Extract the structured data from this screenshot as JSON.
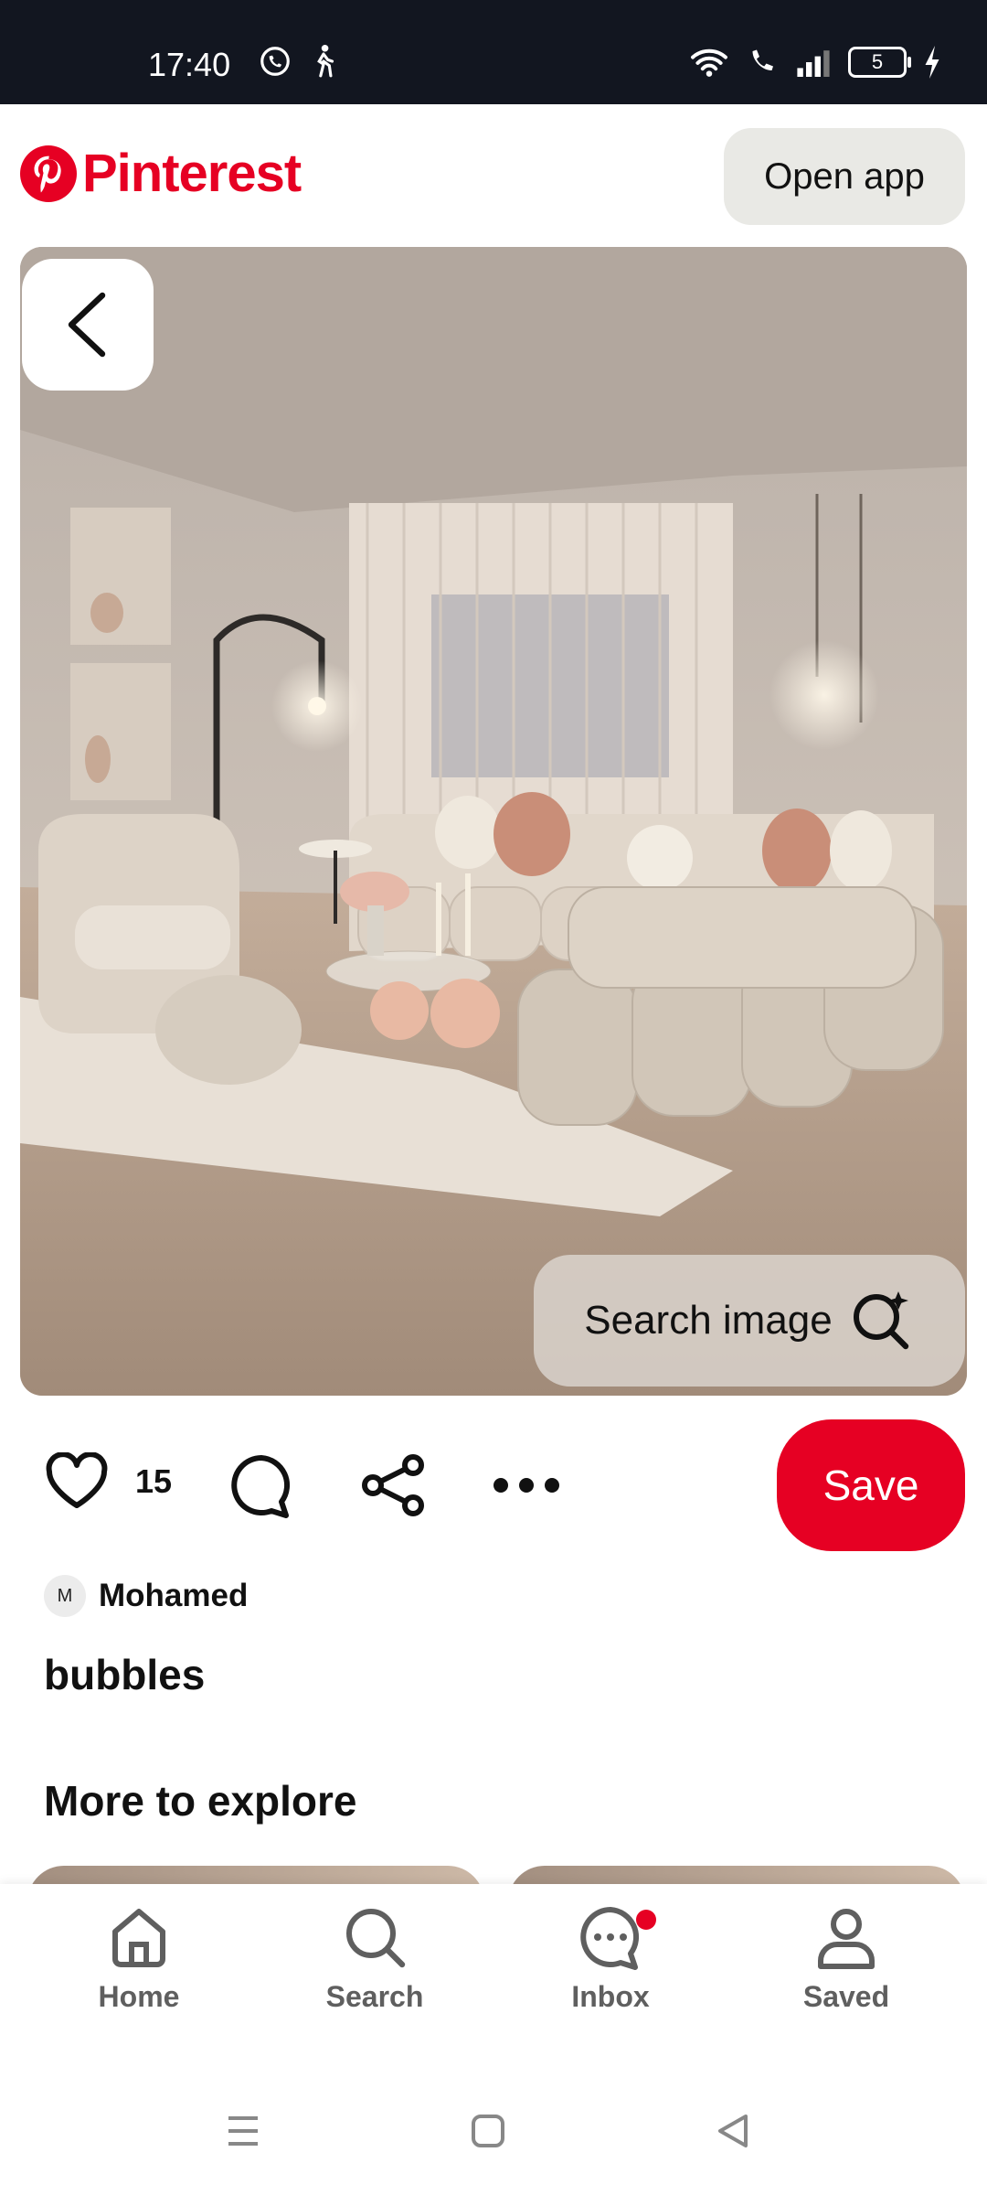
{
  "status_bar": {
    "time": "17:40",
    "battery_level": "5"
  },
  "header": {
    "logo_text": "Pinterest",
    "open_app_label": "Open app",
    "brand_color": "#e60023"
  },
  "pin": {
    "search_image_label": "Search image",
    "like_count": "15",
    "save_label": "Save",
    "author_initial": "M",
    "author_name": "Mohamed",
    "title": "bubbles"
  },
  "more_to_explore": {
    "title": "More to explore"
  },
  "bottom_nav": {
    "items": [
      {
        "label": "Home",
        "icon": "home-icon"
      },
      {
        "label": "Search",
        "icon": "search-icon"
      },
      {
        "label": "Inbox",
        "icon": "inbox-icon",
        "has_notification": true
      },
      {
        "label": "Saved",
        "icon": "profile-icon"
      }
    ]
  }
}
